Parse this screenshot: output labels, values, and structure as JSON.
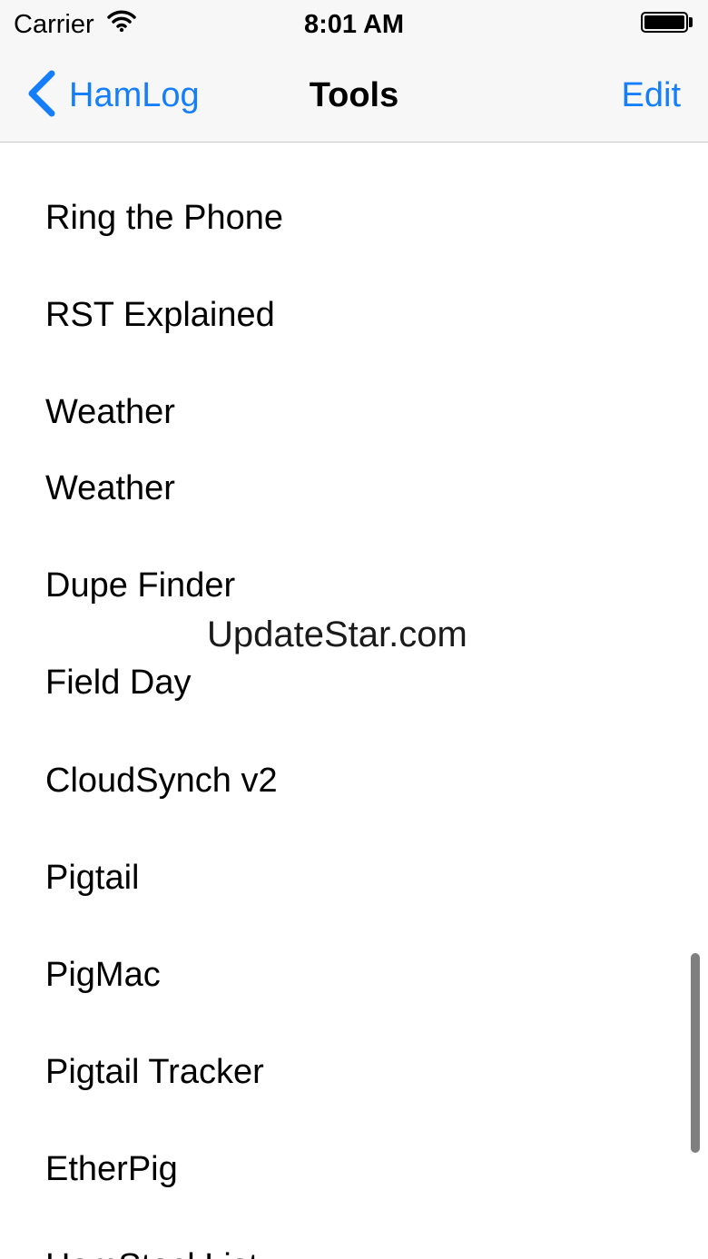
{
  "status_bar": {
    "carrier": "Carrier",
    "time": "8:01 AM"
  },
  "nav": {
    "back_label": "HamLog",
    "title": "Tools",
    "edit_label": "Edit"
  },
  "list": {
    "items": [
      {
        "label": "Ring the Phone"
      },
      {
        "label": "RST Explained"
      },
      {
        "label": "Weather"
      },
      {
        "label": "Weather"
      },
      {
        "label": "Dupe Finder"
      },
      {
        "label": "Field Day"
      },
      {
        "label": "CloudSynch v2"
      },
      {
        "label": "Pigtail"
      },
      {
        "label": "PigMac"
      },
      {
        "label": "Pigtail Tracker"
      },
      {
        "label": "EtherPig"
      },
      {
        "label": "HamStockList"
      }
    ]
  },
  "watermark": "UpdateStar.com",
  "colors": {
    "accent": "#157efb",
    "bar_background": "#f7f7f7",
    "separator": "#c8c7cc",
    "scrollbar": "#7f7f7f"
  }
}
